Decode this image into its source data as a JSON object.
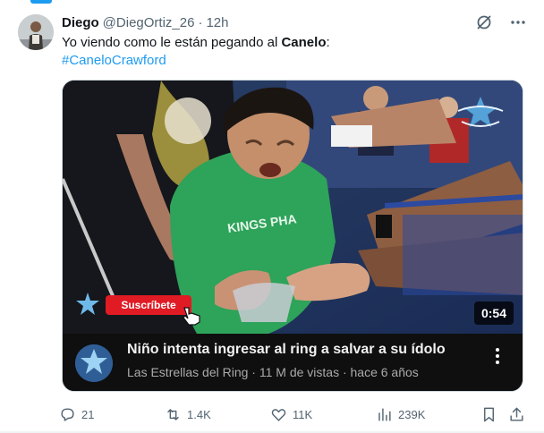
{
  "tweet": {
    "author_name": "Diego",
    "author_handle": "@DiegOrtiz_26",
    "separator": "·",
    "time": "12h",
    "text_before": "Yo viendo como le están pegando al ",
    "text_bold": "Canelo",
    "text_after": ":",
    "hashtag": "#CaneloCrawford"
  },
  "video_card": {
    "duration": "0:54",
    "subscribe_label": "Suscríbete",
    "title": "Niño intenta ingresar al ring a salvar a su ídolo",
    "channel": "Las Estrellas del Ring",
    "separator": "·",
    "views": "11 M de vistas",
    "age": "hace 6 años",
    "meta": "Las Estrellas del Ring · 11 M de vistas · hace 6 años"
  },
  "actions": {
    "replies": "21",
    "retweets": "1.4K",
    "likes": "11K",
    "views": "239K"
  },
  "icons": {
    "grok": "grok-icon",
    "more": "more-icon",
    "reply": "reply-icon",
    "retweet": "retweet-icon",
    "like": "like-icon",
    "views": "views-icon",
    "bookmark": "bookmark-icon",
    "share": "share-icon"
  },
  "colors": {
    "accent": "#1d9bf0",
    "muted": "#536471",
    "text": "#0f1419",
    "subscribe": "#e01b24"
  }
}
